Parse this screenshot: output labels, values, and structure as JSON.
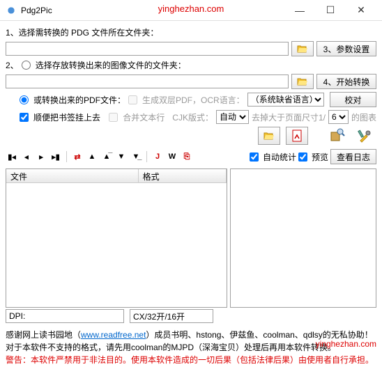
{
  "window": {
    "title": "Pdg2Pic"
  },
  "watermark": "yinghezhan.com",
  "step1": {
    "label": "1、选择需转换的 PDG 文件所在文件夹："
  },
  "step2": {
    "label": "2、",
    "opt": "选择存放转换出来的图像文件的文件夹："
  },
  "opts": {
    "pdf": "或转换出来的PDF文件：",
    "dblpdf": "生成双层PDF，OCR语言：",
    "syslang": "（系统缺省语言）",
    "bookmark": "顺便把书签挂上去",
    "merge": "合并文本行",
    "cjk": "CJK版式：",
    "auto": "自动",
    "trim": "去掉大于页面尺寸1/",
    "trimval": "6",
    "chart": "的图表"
  },
  "btns": {
    "cfg": "3、参数设置",
    "start": "4、开始转换",
    "proof": "校对",
    "log": "查看日志"
  },
  "chks": {
    "autostat": "自动统计",
    "preview": "预览"
  },
  "list": {
    "col1": "文件",
    "col2": "格式"
  },
  "status": {
    "dpi": "DPI:",
    "size": "CX/32开/16开"
  },
  "footer": {
    "l1a": "感谢网上读书园地（",
    "url": "www.readfree.net",
    "l1b": "）成员书明、hstong、伊兹鱼、coolman、qdlsy的无私协助！",
    "l2": "对于本软件不支持的格式，请先用coolman的MJPD（深海宝贝）处理后再用本软件转换。",
    "l3": "警告：本软件严禁用于非法目的。使用本软件造成的一切后果（包括法律后果）由使用者自行承担。"
  },
  "tb": {
    "j": "J",
    "w": "W"
  }
}
